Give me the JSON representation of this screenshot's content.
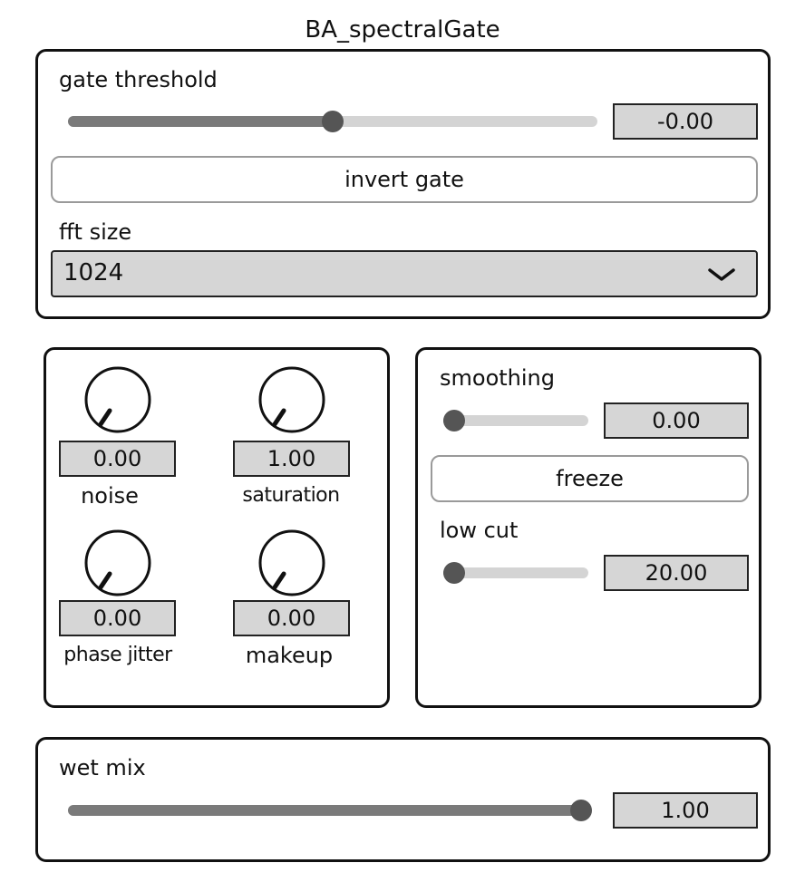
{
  "app": {
    "title": "BA_spectralGate"
  },
  "gate": {
    "threshold_label": "gate threshold",
    "threshold_value": "-0.00",
    "threshold_fraction": 0.5,
    "invert_label": "invert gate",
    "fft_label": "fft size",
    "fft_value": "1024"
  },
  "knobs": [
    {
      "name": "noise",
      "value": "0.00"
    },
    {
      "name": "saturation",
      "value": "1.00"
    },
    {
      "name": "phase jitter",
      "value": "0.00"
    },
    {
      "name": "makeup",
      "value": "0.00"
    }
  ],
  "smoothing": {
    "label": "smoothing",
    "value": "0.00",
    "fraction": 0.0,
    "freeze_label": "freeze"
  },
  "lowcut": {
    "label": "low cut",
    "value": "20.00",
    "fraction": 0.0
  },
  "wet": {
    "label": "wet mix",
    "value": "1.00",
    "fraction": 1.0
  },
  "colors": {
    "slider_track": "#d4d4d4",
    "slider_fill": "#7a7a7a",
    "slider_thumb": "#555555",
    "numbox_bg": "#d6d6d6"
  },
  "icons": {
    "dropdown": "chevron-down-icon"
  }
}
